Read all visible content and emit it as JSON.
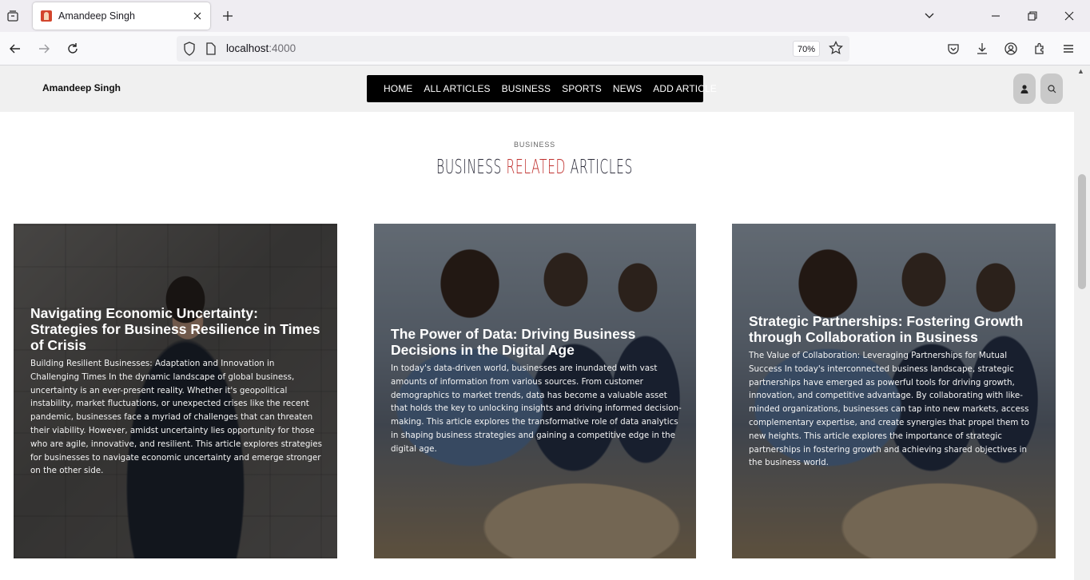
{
  "browser": {
    "tab_title": "Amandeep Singh",
    "url_host": "localhost",
    "url_port": ":4000",
    "zoom": "70%"
  },
  "site": {
    "brand": "Amandeep Singh",
    "nav": [
      "HOME",
      "ALL ARTICLES",
      "BUSINESS",
      "SPORTS",
      "NEWS",
      "ADD ARTICLE"
    ]
  },
  "section": {
    "subtitle": "BUSINESS",
    "title_part1": "BUSINESS",
    "title_accent": "RELATED",
    "title_part2": "ARTICLES"
  },
  "articles": [
    {
      "title": "Navigating Economic Uncertainty: Strategies for Business Resilience in Times of Crisis",
      "body": "Building Resilient Businesses: Adaptation and Innovation in Challenging Times In the dynamic landscape of global business, uncertainty is an ever-present reality. Whether it's geopolitical instability, market fluctuations, or unexpected crises like the recent pandemic, businesses face a myriad of challenges that can threaten their viability. However, amidst uncertainty lies opportunity for those who are agile, innovative, and resilient. This article explores strategies for businesses to navigate economic uncertainty and emerge stronger on the other side."
    },
    {
      "title": "The Power of Data: Driving Business Decisions in the Digital Age",
      "body": "In today's data-driven world, businesses are inundated with vast amounts of information from various sources. From customer demographics to market trends, data has become a valuable asset that holds the key to unlocking insights and driving informed decision-making. This article explores the transformative role of data analytics in shaping business strategies and gaining a competitive edge in the digital age."
    },
    {
      "title": "Strategic Partnerships: Fostering Growth through Collaboration in Business",
      "body": "The Value of Collaboration: Leveraging Partnerships for Mutual Success In today's interconnected business landscape, strategic partnerships have emerged as powerful tools for driving growth, innovation, and competitive advantage. By collaborating with like-minded organizations, businesses can tap into new markets, access complementary expertise, and create synergies that propel them to new heights. This article explores the importance of strategic partnerships in fostering growth and achieving shared objectives in the business world."
    }
  ]
}
